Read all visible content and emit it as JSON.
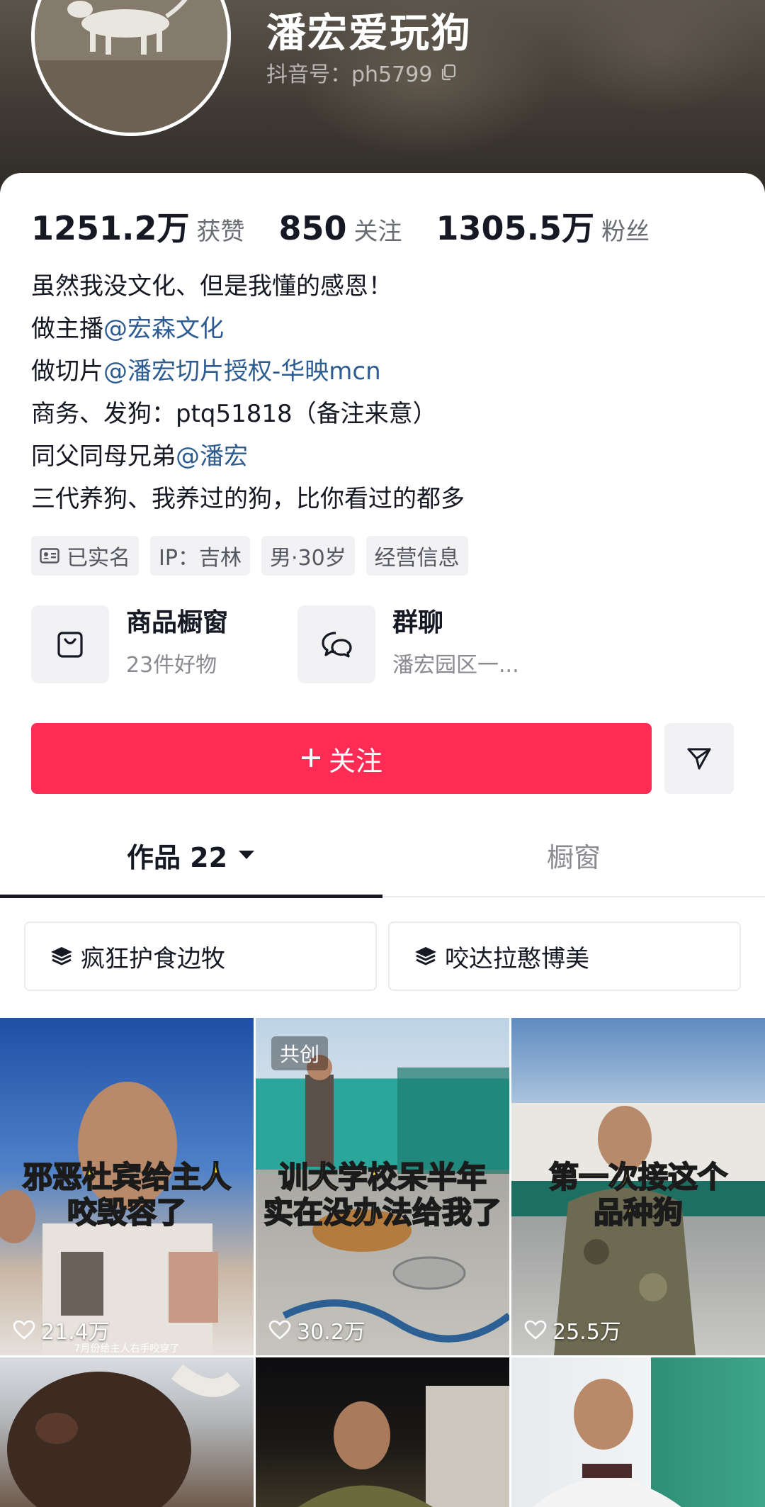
{
  "profile": {
    "nickname": "潘宏爱玩狗",
    "douyin_id": "抖音号：ph5799"
  },
  "stats": {
    "likes_value": "1251.2万",
    "likes_label": "获赞",
    "following_value": "850",
    "following_label": "关注",
    "followers_value": "1305.5万",
    "followers_label": "粉丝"
  },
  "bio": {
    "line1": "虽然我没文化、但是我懂的感恩！",
    "line2_prefix": "做主播",
    "line2_mention": "@宏森文化",
    "line3_prefix": "做切片",
    "line3_mention": "@潘宏切片授权-华映mcn",
    "line4": "商务、发狗：ptq51818（备注来意）",
    "line5_prefix": "同父同母兄弟",
    "line5_mention": "@潘宏",
    "line6": "三代养狗、我养过的狗，比你看过的都多"
  },
  "tags": {
    "verified": "已实名",
    "ip": "IP：吉林",
    "gender_age": "男·30岁",
    "business": "经营信息"
  },
  "features": {
    "shop_title": "商品橱窗",
    "shop_sub": "23件好物",
    "group_title": "群聊",
    "group_sub": "潘宏园区一..."
  },
  "actions": {
    "follow_label": "关注"
  },
  "tabs": {
    "works_label": "作品 22",
    "shop_label": "橱窗"
  },
  "collections": [
    {
      "label": "疯狂护食边牧"
    },
    {
      "label": "咬达拉憨博美"
    }
  ],
  "videos": [
    {
      "caption_line1": "邪恶杜宾给主人",
      "caption_line2": "咬毁容了",
      "likes": "21.4万",
      "subtitle": "7月份给主人右手咬穿了"
    },
    {
      "badge": "共创",
      "caption_line1": "训犬学校呆半年",
      "caption_line2": "实在没办法给我了",
      "likes": "30.2万"
    },
    {
      "caption_line1": "第一次接这个",
      "caption_line2": "品种狗",
      "likes": "25.5万"
    },
    {},
    {},
    {}
  ]
}
